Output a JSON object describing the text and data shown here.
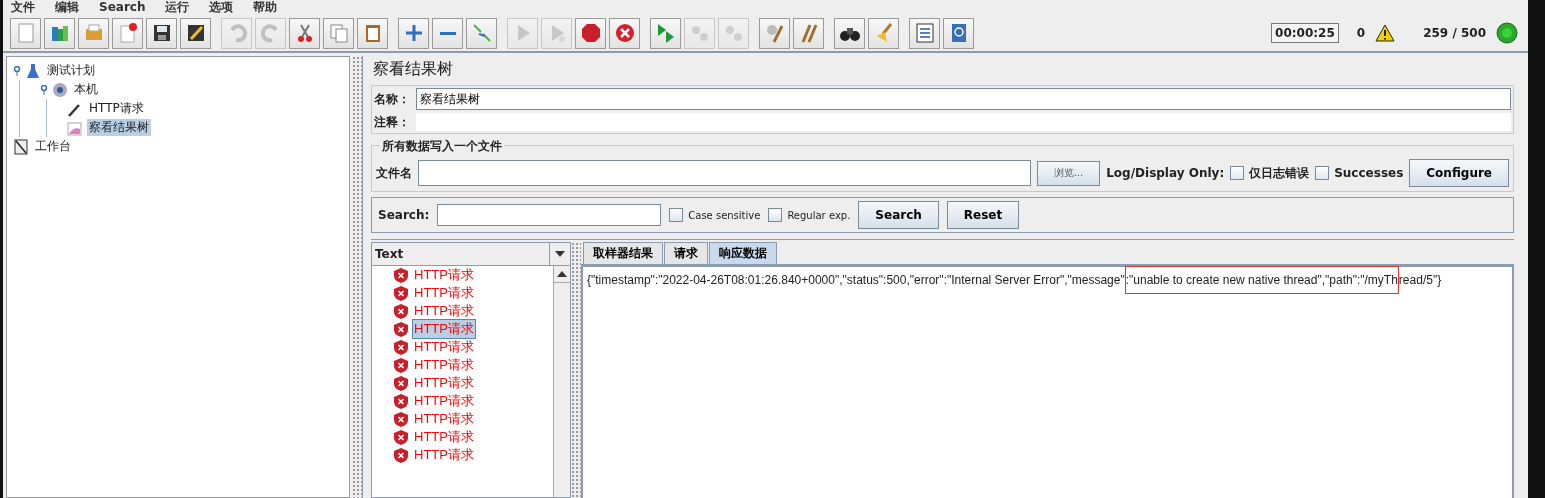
{
  "menu": [
    "文件",
    "编辑",
    "Search",
    "运行",
    "选项",
    "帮助"
  ],
  "toolbar": [
    [
      {
        "kind": "new",
        "disabled": false
      },
      {
        "kind": "templates",
        "disabled": false
      },
      {
        "kind": "open",
        "disabled": false
      },
      {
        "kind": "close",
        "disabled": false
      },
      {
        "kind": "save",
        "disabled": false
      },
      {
        "kind": "save-as",
        "disabled": false
      }
    ],
    [
      {
        "kind": "undo",
        "disabled": true
      },
      {
        "kind": "redo",
        "disabled": true
      },
      {
        "kind": "cut",
        "disabled": false
      },
      {
        "kind": "copy",
        "disabled": false
      },
      {
        "kind": "paste",
        "disabled": false
      }
    ],
    [
      {
        "kind": "expand",
        "disabled": false
      },
      {
        "kind": "collapse",
        "disabled": false
      },
      {
        "kind": "toggle",
        "disabled": false
      }
    ],
    [
      {
        "kind": "start",
        "disabled": true
      },
      {
        "kind": "start-no-pause",
        "disabled": true
      },
      {
        "kind": "stop",
        "disabled": false
      },
      {
        "kind": "shutdown",
        "disabled": false
      }
    ],
    [
      {
        "kind": "remote-start",
        "disabled": false
      },
      {
        "kind": "remote-stop",
        "disabled": true
      },
      {
        "kind": "remote-exit",
        "disabled": true
      }
    ],
    [
      {
        "kind": "clear",
        "disabled": false
      },
      {
        "kind": "clear-all",
        "disabled": false
      }
    ],
    [
      {
        "kind": "search",
        "disabled": false
      },
      {
        "kind": "reset-search",
        "disabled": false
      }
    ],
    [
      {
        "kind": "function-helper",
        "disabled": false
      },
      {
        "kind": "help",
        "disabled": false
      }
    ]
  ],
  "status": {
    "elapsed": "00:00:25",
    "warnings": "0",
    "threads": "259 / 500"
  },
  "tree": [
    {
      "label": "测试计划",
      "kind": "plan",
      "selected": false,
      "children": [
        {
          "label": "本机",
          "kind": "thread-group",
          "selected": false,
          "children": [
            {
              "label": "HTTP请求",
              "kind": "sampler",
              "selected": false
            },
            {
              "label": "察看结果树",
              "kind": "listener",
              "selected": true
            }
          ]
        }
      ]
    },
    {
      "label": "工作台",
      "kind": "workbench",
      "selected": false
    }
  ],
  "panel": {
    "title": "察看结果树",
    "name_label": "名称：",
    "name_value": "察看结果树",
    "comment_label": "注释：",
    "file_group": {
      "title": "所有数据写入一个文件",
      "file_label": "文件名",
      "browse": "浏览...",
      "log_label": "Log/Display Only:",
      "options": [
        {
          "label": "仅日志错误",
          "checked": false
        },
        {
          "label": "Successes",
          "checked": false
        }
      ],
      "configure": "Configure"
    },
    "search": {
      "label": "Search:",
      "options": [
        {
          "label": "Case sensitive",
          "checked": false
        },
        {
          "label": "Regular exp.",
          "checked": false
        }
      ],
      "buttons": [
        "Search",
        "Reset"
      ]
    },
    "renderer": "Text",
    "results": [
      {
        "label": "HTTP请求",
        "error": true,
        "selected": false
      },
      {
        "label": "HTTP请求",
        "error": true,
        "selected": false
      },
      {
        "label": "HTTP请求",
        "error": true,
        "selected": false
      },
      {
        "label": "HTTP请求",
        "error": true,
        "selected": true
      },
      {
        "label": "HTTP请求",
        "error": true,
        "selected": false
      },
      {
        "label": "HTTP请求",
        "error": true,
        "selected": false
      },
      {
        "label": "HTTP请求",
        "error": true,
        "selected": false
      },
      {
        "label": "HTTP请求",
        "error": true,
        "selected": false
      },
      {
        "label": "HTTP请求",
        "error": true,
        "selected": false
      },
      {
        "label": "HTTP请求",
        "error": true,
        "selected": false
      },
      {
        "label": "HTTP请求",
        "error": true,
        "selected": false
      }
    ],
    "tabs": [
      {
        "label": "取样器结果",
        "selected": false
      },
      {
        "label": "请求",
        "selected": false
      },
      {
        "label": "响应数据",
        "selected": true
      }
    ],
    "response": {
      "before": "{\"timestamp\":\"2022-04-26T08:01:26.840+0000\",\"status\":500,\"error\":\"Internal Server Error\",\"message\"",
      "highlighted": ":\"unable to create new native thread\",\"path\":\"/myTh",
      "after": "read/5\"}"
    }
  }
}
